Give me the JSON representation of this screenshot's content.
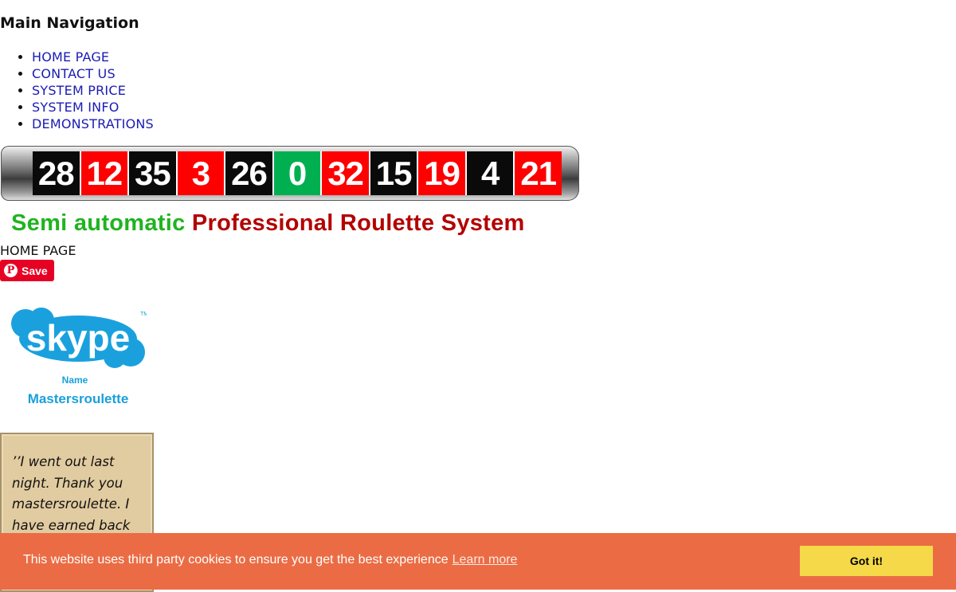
{
  "navigation": {
    "title": "Main Navigation",
    "items": [
      {
        "label": "HOME PAGE"
      },
      {
        "label": "CONTACT US"
      },
      {
        "label": "SYSTEM PRICE"
      },
      {
        "label": "SYSTEM INFO"
      },
      {
        "label": "DEMONSTRATIONS"
      }
    ]
  },
  "banner": {
    "numbers": [
      {
        "value": "28",
        "color": "black"
      },
      {
        "value": "12",
        "color": "red"
      },
      {
        "value": "35",
        "color": "black"
      },
      {
        "value": "3",
        "color": "red"
      },
      {
        "value": "26",
        "color": "black"
      },
      {
        "value": "0",
        "color": "green"
      },
      {
        "value": "32",
        "color": "red"
      },
      {
        "value": "15",
        "color": "black"
      },
      {
        "value": "19",
        "color": "red"
      },
      {
        "value": "4",
        "color": "black"
      },
      {
        "value": "21",
        "color": "red"
      }
    ]
  },
  "headline": {
    "part1": "Semi automatic",
    "part2": "Professional Roulette System",
    "part1_color": "#1fb41f",
    "part2_color": "#b30000"
  },
  "breadcrumb": "HOME PAGE",
  "pinterest": {
    "label": "Save",
    "icon": "pinterest-icon"
  },
  "skype": {
    "logo_text": "skype",
    "name_label": "Name",
    "handle": "Mastersroulette"
  },
  "testimonial": {
    "text": "’’I went out last night. Thank you mastersroulette. I have earned back my"
  },
  "cookie": {
    "message": "This website uses third party cookies to ensure you get the best experience",
    "learn_more": "Learn more",
    "button": "Got it!",
    "bar_color": "#eb6c44",
    "button_color": "#f5d948"
  }
}
